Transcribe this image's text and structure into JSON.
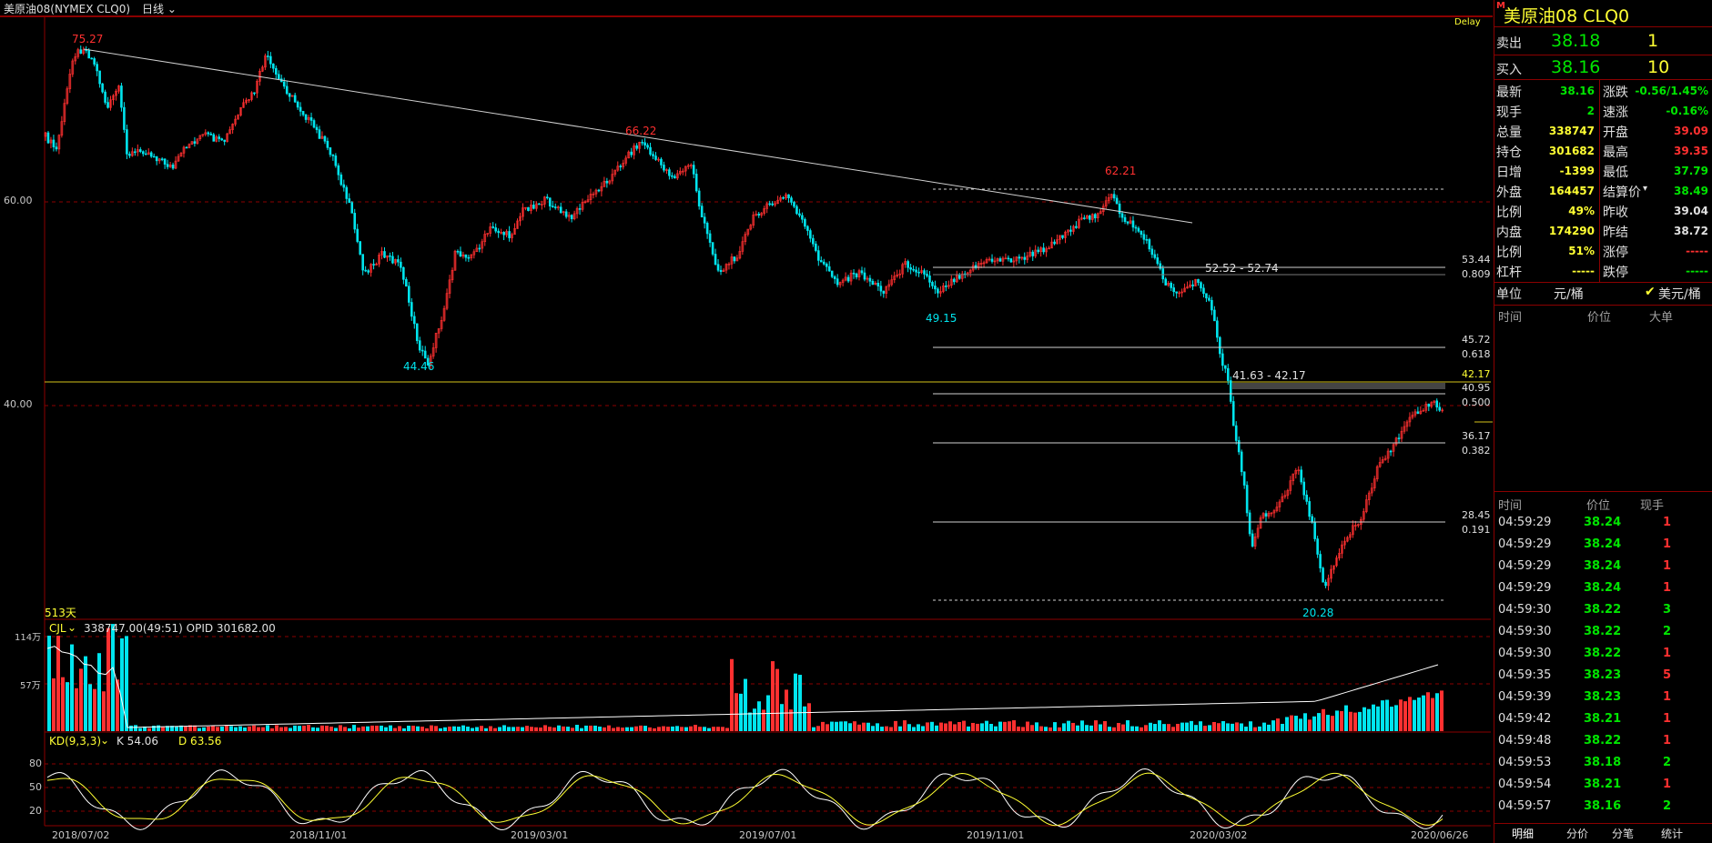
{
  "header": {
    "symbol_label": "美原油08(NYMEX CLQ0)",
    "period_label": "日线",
    "delay_label": "Delay",
    "days_label": "513天"
  },
  "colors": {
    "up": "#ff3030",
    "down": "#00e5ee",
    "accent": "#ffff33",
    "grid_red": "#8b0000"
  },
  "chart_data": {
    "type": "candlestick",
    "y_ticks": [
      "60.00",
      "40.00"
    ],
    "x_ticks": [
      "2018/07/02",
      "2018/11/01",
      "2019/03/01",
      "2019/07/01",
      "2019/11/01",
      "2020/03/02",
      "2020/06/26"
    ],
    "annotations": {
      "peaks": [
        "75.27",
        "66.22",
        "62.21"
      ],
      "troughs": [
        "44.46",
        "49.15",
        "20.28"
      ],
      "ranges": [
        "52.52 - 52.74",
        "41.63 - 42.17"
      ]
    },
    "fibonacci": [
      {
        "price": "53.44",
        "ratio": "0.809"
      },
      {
        "price": "45.72",
        "ratio": "0.618"
      },
      {
        "price": "42.17",
        "ratio": ""
      },
      {
        "price": "40.95",
        "ratio": "0.500"
      },
      {
        "price": "36.17",
        "ratio": "0.382"
      },
      {
        "price": "28.45",
        "ratio": "0.191"
      }
    ],
    "volume": {
      "label": "CJL",
      "info": "338747.00(49:51)  OPID 301682.00",
      "y_ticks": [
        "114万",
        "57万"
      ]
    },
    "kd": {
      "label": "KD(9,3,3)",
      "k_text": "K 54.06",
      "d_text": "D 63.56",
      "y_ticks": [
        "80",
        "50",
        "20"
      ]
    }
  },
  "quote": {
    "title": "美原油08  CLQ0",
    "ask_label": "卖出",
    "ask_price": "38.18",
    "ask_size": "1",
    "bid_label": "买入",
    "bid_price": "38.16",
    "bid_size": "10",
    "left": [
      {
        "label": "最新",
        "value": "38.16"
      },
      {
        "label": "现手",
        "value": "2"
      },
      {
        "label": "总量",
        "value": "338747"
      },
      {
        "label": "持仓",
        "value": "301682"
      },
      {
        "label": "日增",
        "value": "-1399"
      },
      {
        "label": "外盘",
        "value": "164457"
      },
      {
        "label": "比例",
        "value": "49%"
      },
      {
        "label": "内盘",
        "value": "174290"
      },
      {
        "label": "比例",
        "value": "51%"
      },
      {
        "label": "杠杆",
        "value": "-----"
      }
    ],
    "right": [
      {
        "label": "涨跌",
        "value": "-0.56/1.45%"
      },
      {
        "label": "速涨",
        "value": "-0.16%"
      },
      {
        "label": "开盘",
        "value": "39.09"
      },
      {
        "label": "最高",
        "value": "39.35"
      },
      {
        "label": "最低",
        "value": "37.79"
      },
      {
        "label": "结算价",
        "value": "38.49"
      },
      {
        "label": "昨收",
        "value": "39.04"
      },
      {
        "label": "昨结",
        "value": "38.72"
      },
      {
        "label": "涨停",
        "value": "-----"
      },
      {
        "label": "跌停",
        "value": "-----"
      }
    ],
    "unit_label": "单位",
    "unit_a": "元/桶",
    "unit_b": "美元/桶",
    "big_header": [
      "时间",
      "价位",
      "大单"
    ],
    "trade_header": [
      "时间",
      "价位",
      "现手"
    ],
    "trades": [
      {
        "time": "04:59:29",
        "price": "38.24",
        "size": "1"
      },
      {
        "time": "04:59:29",
        "price": "38.24",
        "size": "1"
      },
      {
        "time": "04:59:29",
        "price": "38.24",
        "size": "1"
      },
      {
        "time": "04:59:29",
        "price": "38.24",
        "size": "1"
      },
      {
        "time": "04:59:30",
        "price": "38.22",
        "size": "3"
      },
      {
        "time": "04:59:30",
        "price": "38.22",
        "size": "2"
      },
      {
        "time": "04:59:30",
        "price": "38.22",
        "size": "1"
      },
      {
        "time": "04:59:35",
        "price": "38.23",
        "size": "5"
      },
      {
        "time": "04:59:39",
        "price": "38.23",
        "size": "1"
      },
      {
        "time": "04:59:42",
        "price": "38.21",
        "size": "1"
      },
      {
        "time": "04:59:48",
        "price": "38.22",
        "size": "1"
      },
      {
        "time": "04:59:53",
        "price": "38.18",
        "size": "2"
      },
      {
        "time": "04:59:54",
        "price": "38.21",
        "size": "1"
      },
      {
        "time": "04:59:57",
        "price": "38.16",
        "size": "2"
      }
    ],
    "tabs": [
      "明细",
      "分价",
      "分笔",
      "统计"
    ]
  }
}
